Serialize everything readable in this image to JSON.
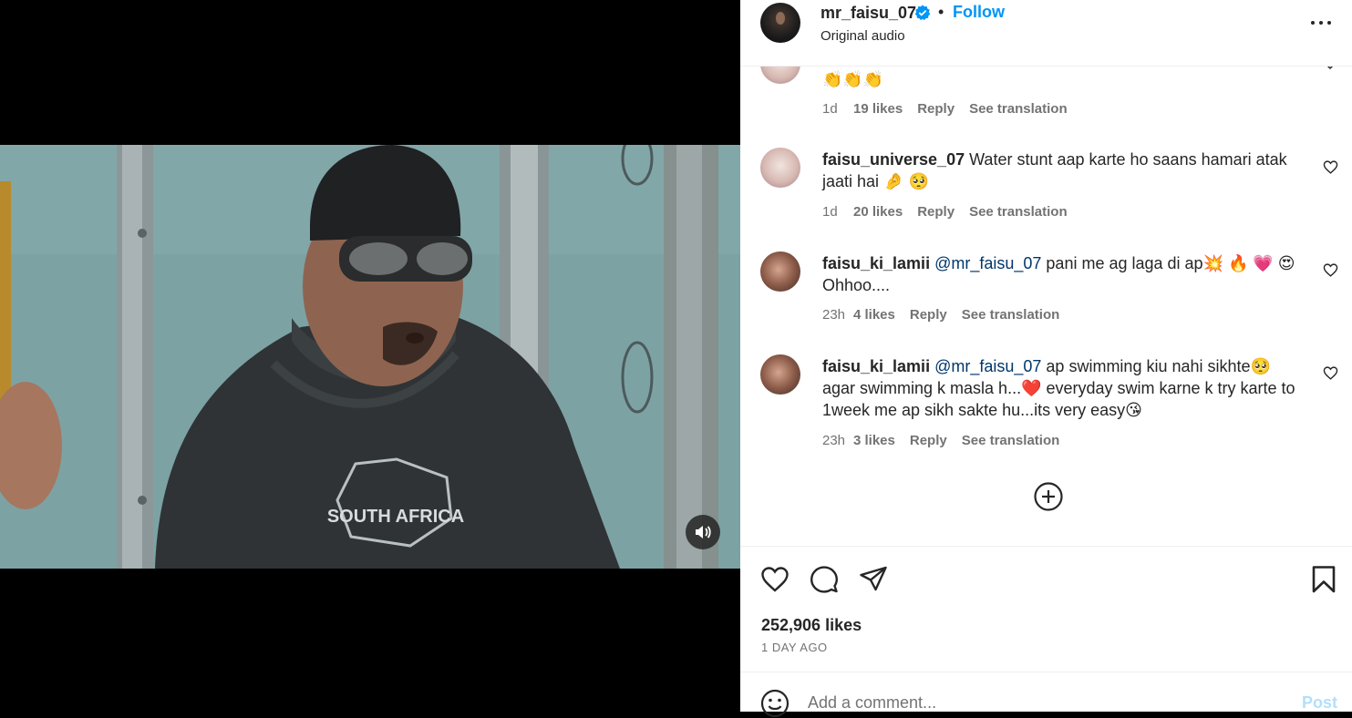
{
  "post": {
    "username": "mr_faisu_07",
    "follow_label": "Follow",
    "dot": "•",
    "audio_label": "Original audio"
  },
  "comments": [
    {
      "username": "",
      "text": "👏👏👏",
      "time": "1d",
      "likes": "19 likes",
      "reply": "Reply",
      "translation": "See translation"
    },
    {
      "username": "faisu_universe_07",
      "text": "Water stunt aap karte ho saans hamari atak jaati hai 🤌 🥺",
      "time": "1d",
      "likes": "20 likes",
      "reply": "Reply",
      "translation": "See translation"
    },
    {
      "username": "faisu_ki_lamii",
      "mention": "@mr_faisu_07",
      "text": " pani me ag laga di ap💥 🔥 💗 😍 Ohhoo....",
      "time": "23h",
      "likes": "4 likes",
      "reply": "Reply",
      "translation": "See translation"
    },
    {
      "username": "faisu_ki_lamii",
      "mention": "@mr_faisu_07",
      "text": " ap swimming kiu nahi sikhte🥺 agar swimming k masla h...❤️  everyday swim karne k try karte to 1week me ap sikh sakte hu...its very easy😘",
      "time": "23h",
      "likes": "3 likes",
      "reply": "Reply",
      "translation": "See translation"
    }
  ],
  "video": {
    "shirt_text": "SOUTH AFRICA"
  },
  "stats": {
    "likes": "252,906 likes",
    "time_ago": "1 DAY AGO"
  },
  "composer": {
    "placeholder": "Add a comment...",
    "post_label": "Post"
  },
  "icons": {
    "verified": "verified-badge-icon",
    "more": "more-options-icon",
    "like": "heart-icon",
    "comment": "comment-bubble-icon",
    "share": "paper-plane-icon",
    "save": "bookmark-icon",
    "emoji": "smiley-icon",
    "load_more": "plus-circle-icon",
    "mute": "speaker-icon"
  },
  "colors": {
    "accent": "#0095f6",
    "mention": "#00376b",
    "muted": "#737373",
    "post_disabled": "#b2dffc"
  }
}
